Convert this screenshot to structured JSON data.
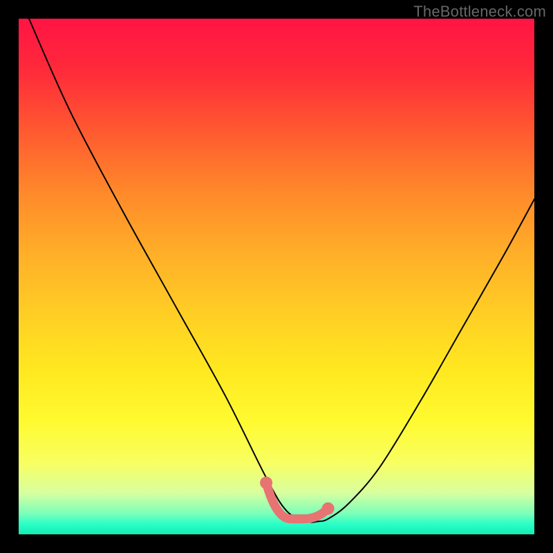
{
  "watermark": "TheBottleneck.com",
  "chart_data": {
    "type": "line",
    "title": "",
    "xlabel": "",
    "ylabel": "",
    "xlim": [
      0,
      100
    ],
    "ylim": [
      0,
      100
    ],
    "series": [
      {
        "name": "curve",
        "x": [
          2,
          10,
          20,
          30,
          40,
          48,
          52,
          56,
          58,
          60,
          64,
          70,
          78,
          86,
          94,
          100
        ],
        "y": [
          100,
          82,
          63,
          45,
          27,
          11,
          4.5,
          2.5,
          2.5,
          3,
          6,
          13,
          26,
          40,
          54,
          65
        ]
      }
    ],
    "flat_region": {
      "x_start": 48,
      "x_end": 60,
      "y": 3,
      "color": "#e77373"
    },
    "gradient_colors": {
      "top": "#ff1444",
      "mid": "#ffd024",
      "bottom": "#14ecb0"
    }
  }
}
